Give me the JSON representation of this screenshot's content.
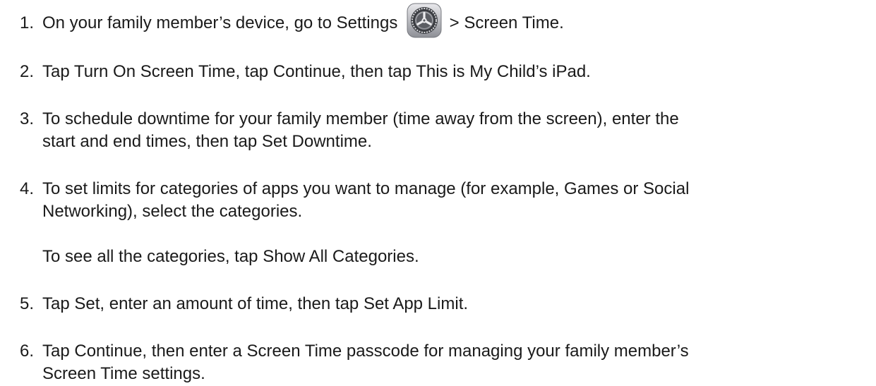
{
  "steps": [
    {
      "number": "1.",
      "text_before": "On your family member’s device, go to Settings",
      "icon": "settings-gear-icon",
      "text_after": "> Screen Time."
    },
    {
      "number": "2.",
      "text": "Tap Turn On Screen Time, tap Continue, then tap This is My Child’s iPad."
    },
    {
      "number": "3.",
      "line1": "To schedule downtime for your family member (time away from the screen), enter the",
      "line2": "start and end times, then tap Set Downtime."
    },
    {
      "number": "4.",
      "line1": "To set limits for categories of apps you want to manage (for example, Games or Social",
      "line2": "Networking), select the categories.",
      "note": "To see all the categories, tap Show All Categories."
    },
    {
      "number": "5.",
      "text": "Tap Set, enter an amount of time, then tap Set App Limit."
    },
    {
      "number": "6.",
      "line1": "Tap Continue, then enter a Screen Time passcode for managing your family member’s",
      "line2": "Screen Time settings."
    }
  ]
}
